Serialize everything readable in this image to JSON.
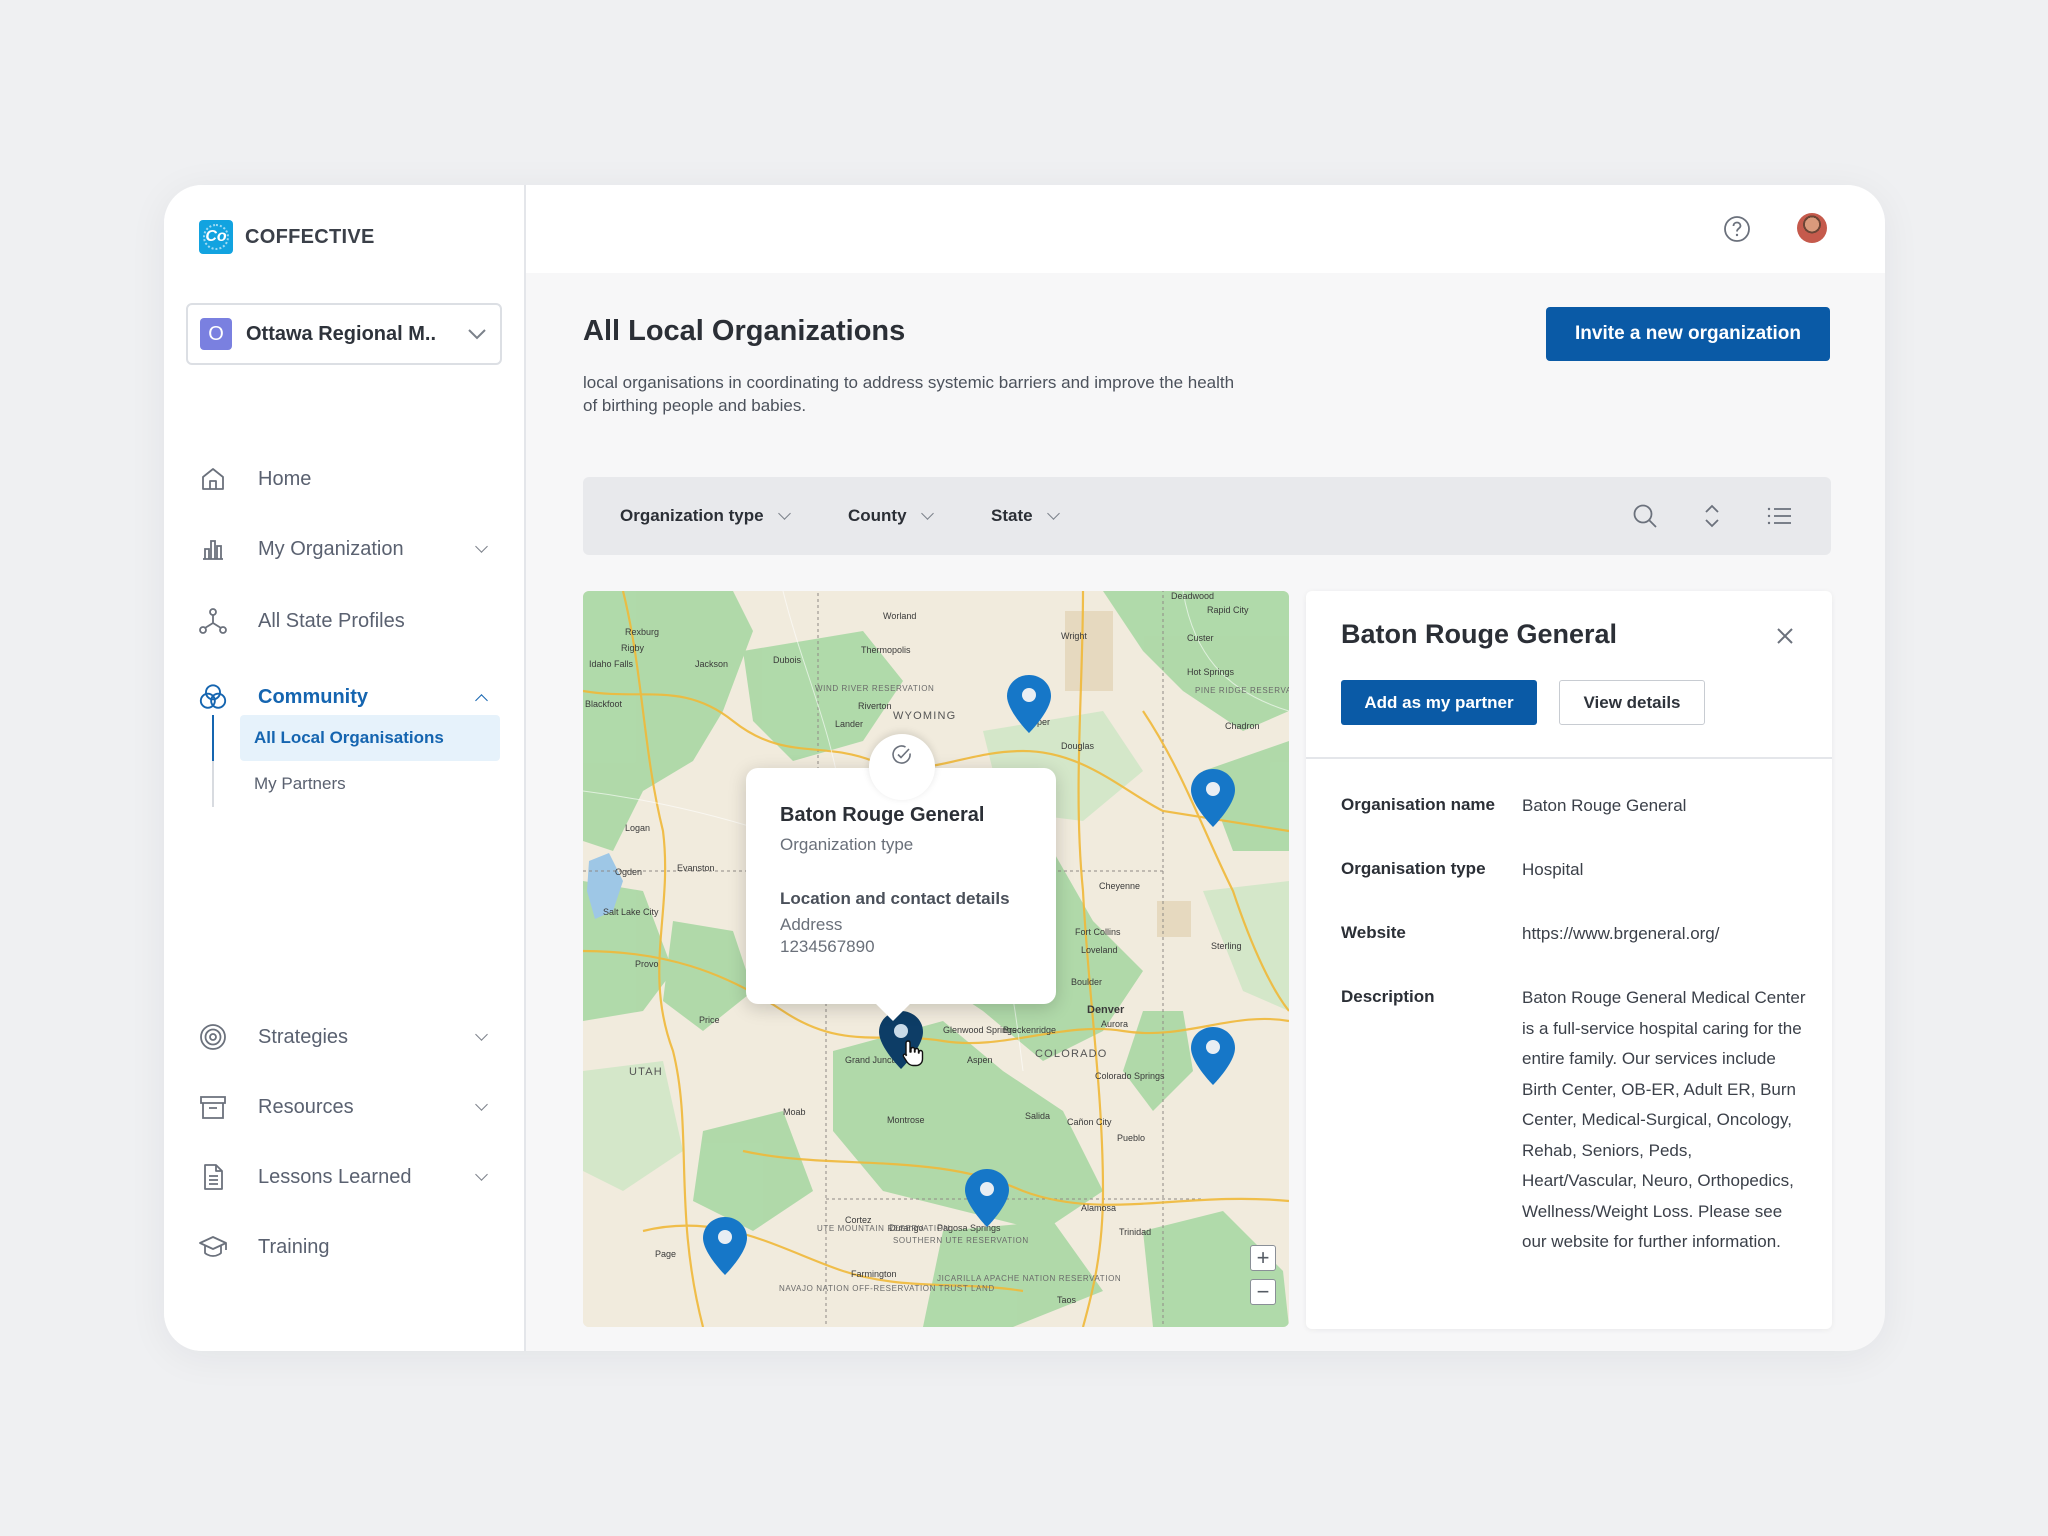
{
  "app": {
    "name": "COFFECTIVE",
    "logo_glyph": "Co",
    "accent": "#0a5aa6",
    "brand_color": "#12a3e0"
  },
  "org_selector": {
    "avatar_letter": "O",
    "name": "Ottawa Regional M.."
  },
  "sidebar": {
    "items": [
      {
        "label": "Home",
        "icon": "home-icon"
      },
      {
        "label": "My Organization",
        "icon": "bar-chart-icon"
      },
      {
        "label": "All State Profiles",
        "icon": "network-icon"
      },
      {
        "label": "Community",
        "icon": "community-icon"
      },
      {
        "label": "Strategies",
        "icon": "target-icon"
      },
      {
        "label": "Resources",
        "icon": "archive-icon"
      },
      {
        "label": "Lessons Learned",
        "icon": "document-icon"
      },
      {
        "label": "Training",
        "icon": "graduation-cap-icon"
      }
    ],
    "community_sub": [
      {
        "label": "All Local Organisations"
      },
      {
        "label": "My Partners"
      }
    ]
  },
  "header": {
    "help_icon": "help-icon",
    "avatar": "user-avatar"
  },
  "page": {
    "title": "All Local Organizations",
    "description": "local organisations in coordinating to address systemic barriers and improve the health of birthing people and babies.",
    "invite_label": "Invite a new organization"
  },
  "filters": {
    "organization_type": "Organization type",
    "county": "County",
    "state": "State",
    "icons": [
      "search-icon",
      "sort-icon",
      "list-view-icon"
    ]
  },
  "map": {
    "labels": {
      "wyoming": "WYOMING",
      "utah": "UTAH",
      "colorado": "COLORADO",
      "denver": "Denver",
      "salt_lake_city": "Salt Lake City",
      "cheyenne": "Cheyenne",
      "fort_collins": "Fort Collins",
      "boulder": "Boulder",
      "aspen": "Aspen",
      "grand_junction": "Grand Junction",
      "durango": "Durango",
      "pueblo": "Pueblo",
      "colorado_springs": "Colorado Springs",
      "casper": "Casper",
      "logan": "Logan",
      "provo": "Provo",
      "moab": "Moab",
      "montrose": "Montrose",
      "taos": "Taos",
      "farmington": "Farmington",
      "trinidad": "Trinidad",
      "sterling": "Sterling",
      "rapid_city": "Rapid City",
      "thermopolis": "Thermopolis",
      "jackson": "Jackson",
      "riverton": "Riverton",
      "lander": "Lander",
      "douglas": "Douglas",
      "ogden": "Ogden",
      "evanston": "Evanston",
      "price": "Price",
      "cortez": "Cortez",
      "alamosa": "Alamosa",
      "salida": "Salida",
      "aurora": "Aurora",
      "loveland": "Loveland",
      "rexburg": "Rexburg",
      "dubois": "Dubois",
      "worland": "Worland",
      "wright": "Wright",
      "deadwood": "Deadwood",
      "custer": "Custer",
      "hot_springs": "Hot Springs",
      "chadron": "Chadron",
      "idaho_falls": "Idaho Falls",
      "blackfoot": "Blackfoot",
      "rigby": "Rigby",
      "pagosa_springs": "Pagosa Springs",
      "glenwood_springs": "Glenwood Springs",
      "breckenridge": "Breckenridge",
      "canon_city": "Cañon City",
      "page": "Page",
      "wind_river": "WIND RIVER RESERVATION",
      "pine_ridge": "PINE RIDGE RESERVATION",
      "ute_mountain": "UTE MOUNTAIN RESERVATION",
      "southern_ute": "SOUTHERN UTE RESERVATION",
      "jicarilla": "JICARILLA APACHE NATION RESERVATION",
      "navajo": "NAVAJO NATION OFF-RESERVATION TRUST LAND"
    },
    "pin_color": "#1677c8",
    "selected_pin_color": "#0d3d66",
    "zoom_in": "+",
    "zoom_out": "−",
    "popup": {
      "title": "Baton Rouge General",
      "subtitle": "Organization type",
      "section": "Location and contact details",
      "address": "Address",
      "phone": "1234567890"
    }
  },
  "detail": {
    "title": "Baton Rouge General",
    "add_partner_label": "Add as my partner",
    "view_details_label": "View details",
    "fields": [
      {
        "key": "Organisation name",
        "value": "Baton Rouge General"
      },
      {
        "key": "Organisation type",
        "value": "Hospital"
      },
      {
        "key": "Website",
        "value": "https://www.brgeneral.org/"
      },
      {
        "key": "Description",
        "value": "Baton Rouge General Medical Center is a full-service hospital caring for the entire family. Our services include Birth Center, OB-ER, Adult ER, Burn Center, Medical-Surgical, Oncology, Rehab, Seniors, Peds, Heart/Vascular, Neuro, Orthopedics, Wellness/Weight Loss. Please see our website for further information."
      }
    ]
  }
}
